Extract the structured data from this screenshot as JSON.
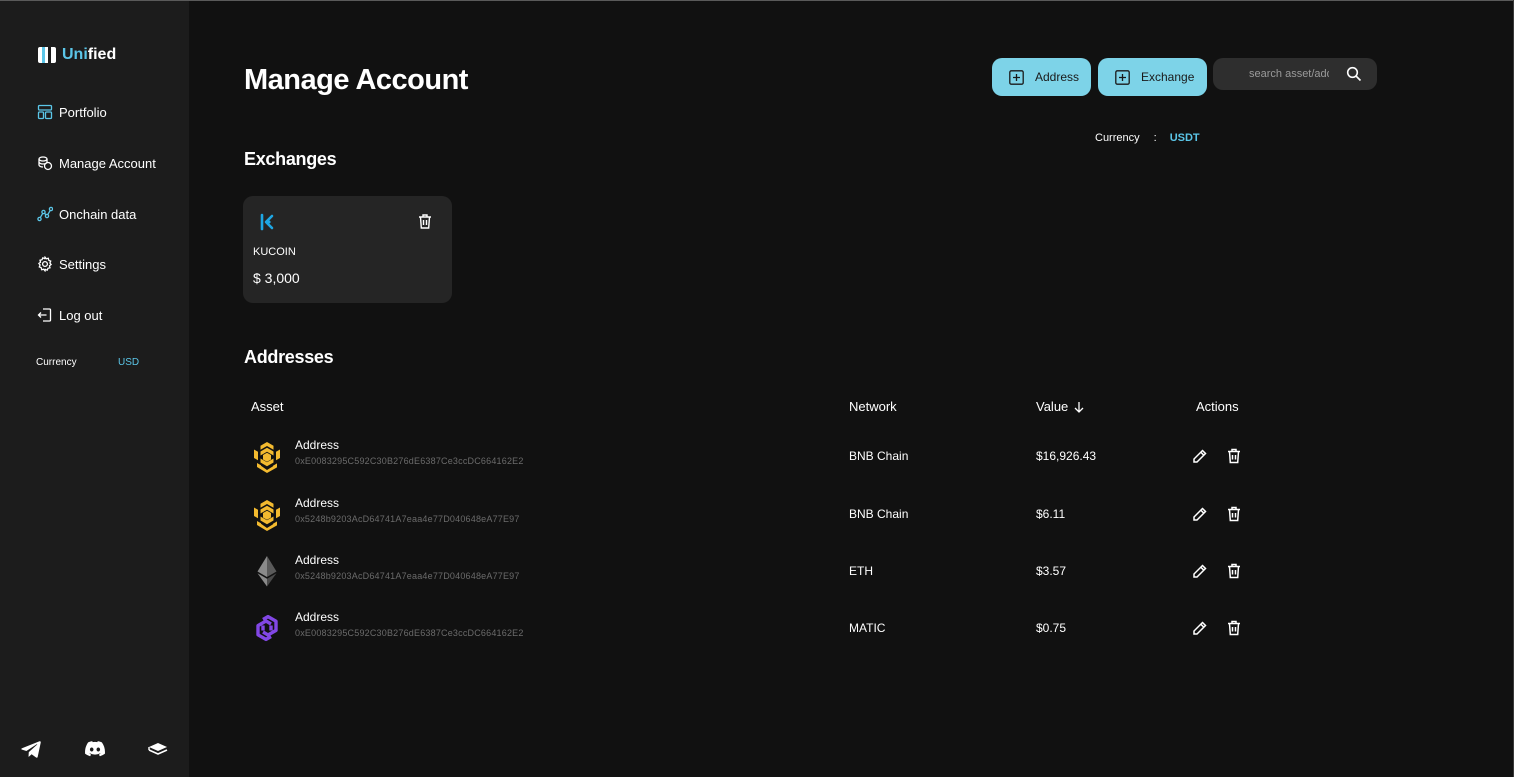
{
  "sidebar": {
    "brand": {
      "prefix": "Uni",
      "suffix": "fied"
    },
    "nav": [
      {
        "label": "Portfolio",
        "icon": "layout-icon"
      },
      {
        "label": "Manage Account",
        "icon": "coins-icon"
      },
      {
        "label": "Onchain data",
        "icon": "chart-line-icon"
      },
      {
        "label": "Settings",
        "icon": "gear-icon"
      },
      {
        "label": "Log out",
        "icon": "logout-icon"
      }
    ],
    "currency_label": "Currency",
    "currency_value": "USD",
    "social": [
      "telegram-icon",
      "discord-icon",
      "book-icon"
    ]
  },
  "header": {
    "title": "Manage Account",
    "add_address_label": "Address",
    "add_exchange_label": "Exchange",
    "search_placeholder": "search asset/address",
    "currency_label": "Currency",
    "currency_sep": ":",
    "currency_value": "USDT"
  },
  "exchanges": {
    "title": "Exchanges",
    "items": [
      {
        "name": "KUCOIN",
        "amount": "$ 3,000",
        "icon": "kucoin-icon"
      }
    ]
  },
  "addresses": {
    "title": "Addresses",
    "columns": {
      "asset": "Asset",
      "network": "Network",
      "value": "Value",
      "actions": "Actions"
    },
    "rows": [
      {
        "label": "Address",
        "address": "0xE0083295C592C30B276dE6387Ce3ccDC664162E2",
        "network": "BNB Chain",
        "value": "$16,926.43",
        "icon": "bnb-icon"
      },
      {
        "label": "Address",
        "address": "0x5248b9203AcD64741A7eaa4e77D040648eA77E97",
        "network": "BNB Chain",
        "value": "$6.11",
        "icon": "bnb-icon"
      },
      {
        "label": "Address",
        "address": "0x5248b9203AcD64741A7eaa4e77D040648eA77E97",
        "network": "ETH",
        "value": "$3.57",
        "icon": "eth-icon"
      },
      {
        "label": "Address",
        "address": "0xE0083295C592C30B276dE6387Ce3ccDC664162E2",
        "network": "MATIC",
        "value": "$0.75",
        "icon": "matic-icon"
      }
    ]
  },
  "colors": {
    "accent": "#5bc6e8",
    "button": "#7dd3e8",
    "bnb": "#f3ba2f",
    "matic": "#8247e5",
    "kucoin": "#23af91"
  }
}
